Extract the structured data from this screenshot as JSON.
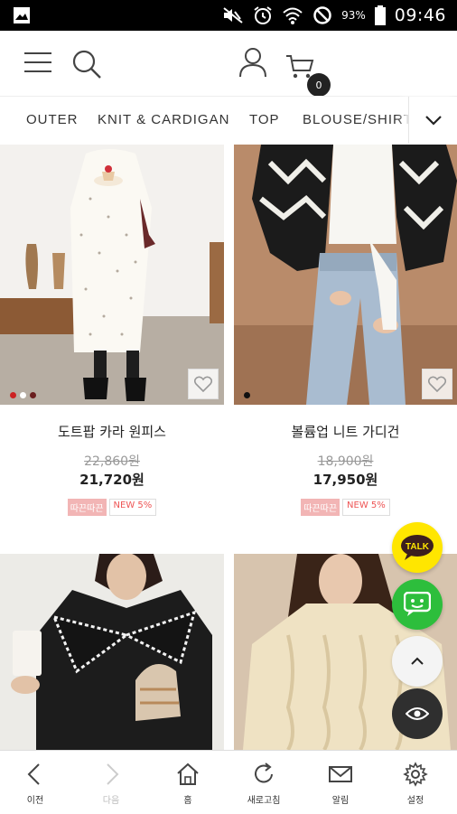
{
  "status_bar": {
    "battery": "93%",
    "time": "09:46"
  },
  "header": {
    "cart_count": "0"
  },
  "categories": [
    "OUTER",
    "KNIT & CARDIGAN",
    "TOP",
    "BLOUSE/SHIRT"
  ],
  "products": [
    {
      "name": "도트팝 카라 원피스",
      "original_price": "22,860원",
      "sale_price": "21,720원",
      "badges": [
        "따끈따끈",
        "NEW 5%"
      ]
    },
    {
      "name": "볼륨업 니트 가디건",
      "original_price": "18,900원",
      "sale_price": "17,950원",
      "badges": [
        "따끈따끈",
        "NEW 5%"
      ]
    },
    {
      "name": ""
    },
    {
      "name": ""
    }
  ],
  "floating": {
    "talk_label": "TALK"
  },
  "bottom_nav": [
    {
      "label": "이전",
      "icon": "back-arrow-icon"
    },
    {
      "label": "다음",
      "icon": "forward-arrow-icon"
    },
    {
      "label": "홈",
      "icon": "home-icon"
    },
    {
      "label": "새로고침",
      "icon": "refresh-icon"
    },
    {
      "label": "알림",
      "icon": "mail-icon"
    },
    {
      "label": "설정",
      "icon": "gear-icon"
    }
  ],
  "colors": {
    "accent_yellow": "#FFE600",
    "accent_green": "#2DBE3C",
    "badge_pink": "#F2B5B5"
  }
}
